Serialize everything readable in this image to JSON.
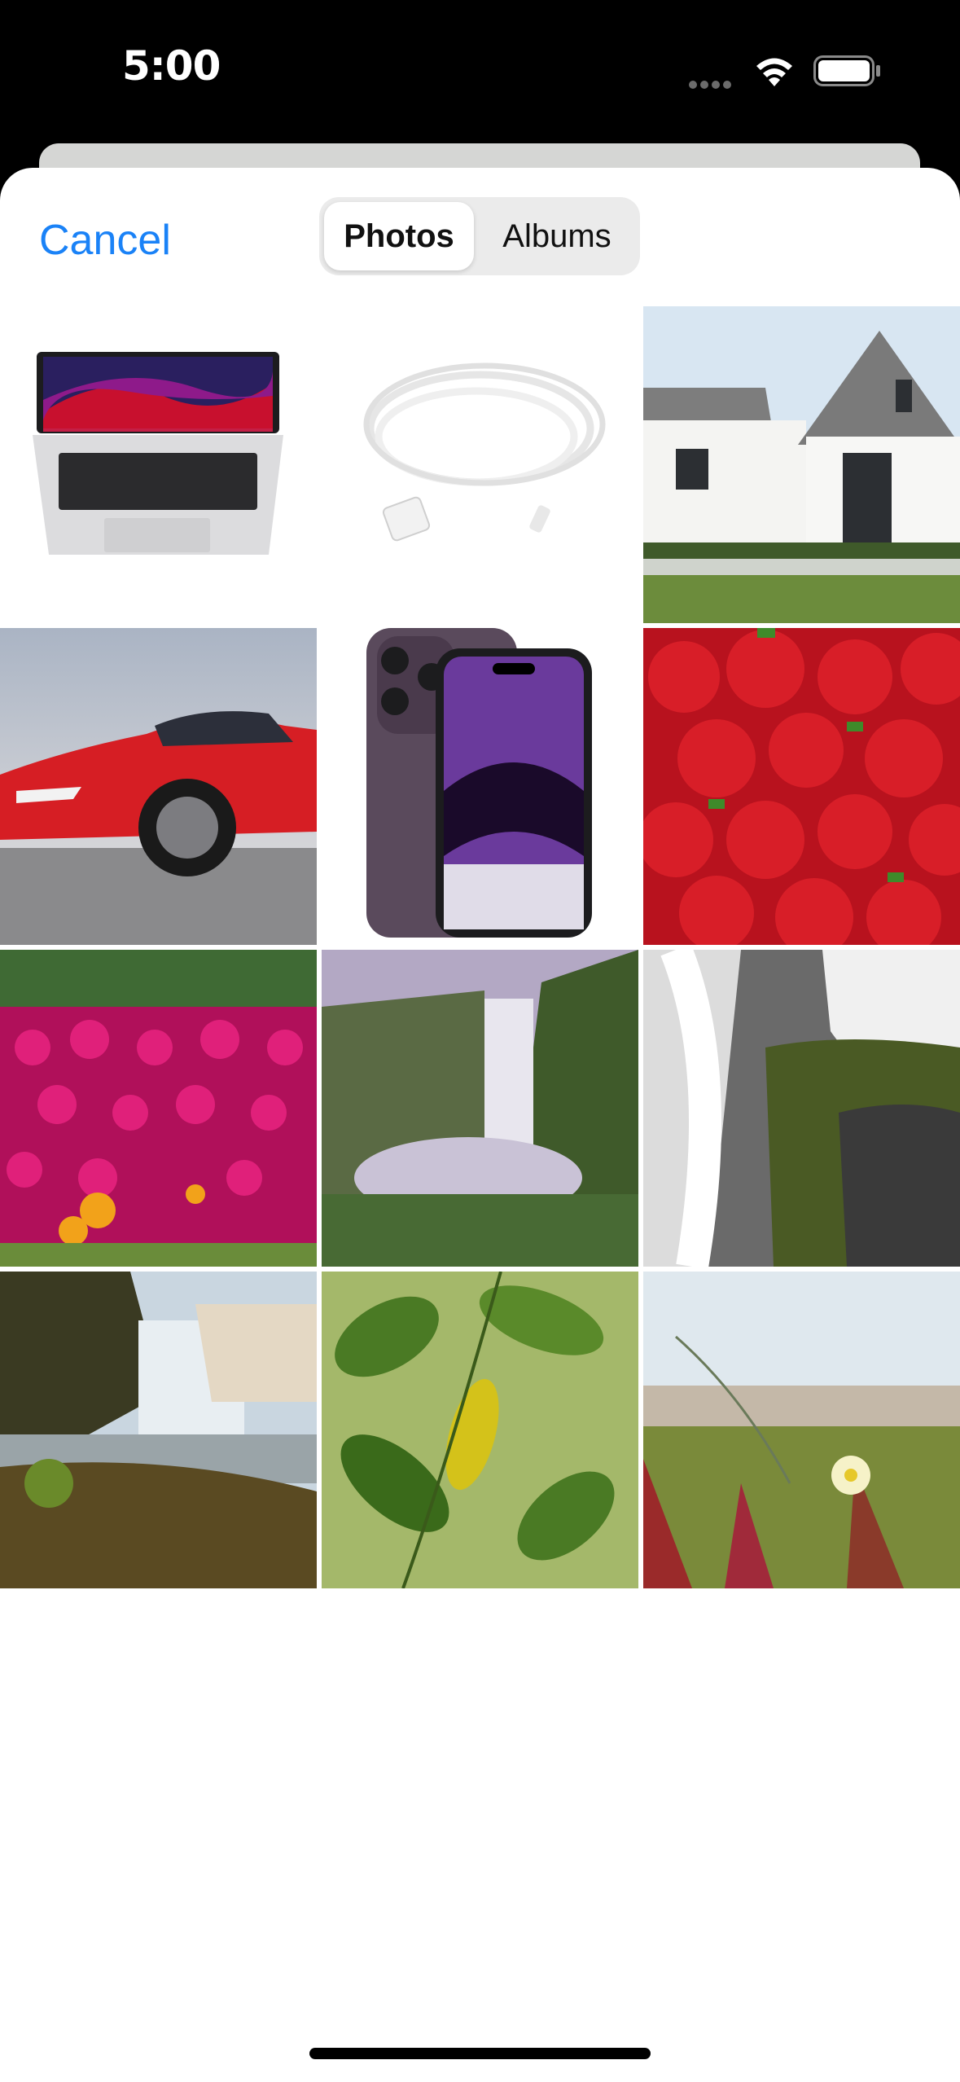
{
  "status_bar": {
    "time": "5:00",
    "icons": [
      "cellular-icon",
      "wifi-icon",
      "battery-icon"
    ]
  },
  "picker": {
    "cancel_label": "Cancel",
    "tabs": [
      {
        "label": "Photos",
        "selected": true
      },
      {
        "label": "Albums",
        "selected": false
      }
    ]
  },
  "colors": {
    "accent": "#1a82f7",
    "sheet_background": "#ffffff",
    "segment_background": "#ebebeb"
  },
  "photos": [
    {
      "subject": "laptop"
    },
    {
      "subject": "usb-cable"
    },
    {
      "subject": "white-house"
    },
    {
      "subject": "red-car"
    },
    {
      "subject": "purple-phone"
    },
    {
      "subject": "strawberries"
    },
    {
      "subject": "pink-flowers"
    },
    {
      "subject": "waterfall-valley"
    },
    {
      "subject": "waterfall-rocks"
    },
    {
      "subject": "waterfall-sunlit"
    },
    {
      "subject": "green-leaves"
    },
    {
      "subject": "beach-flower"
    }
  ]
}
